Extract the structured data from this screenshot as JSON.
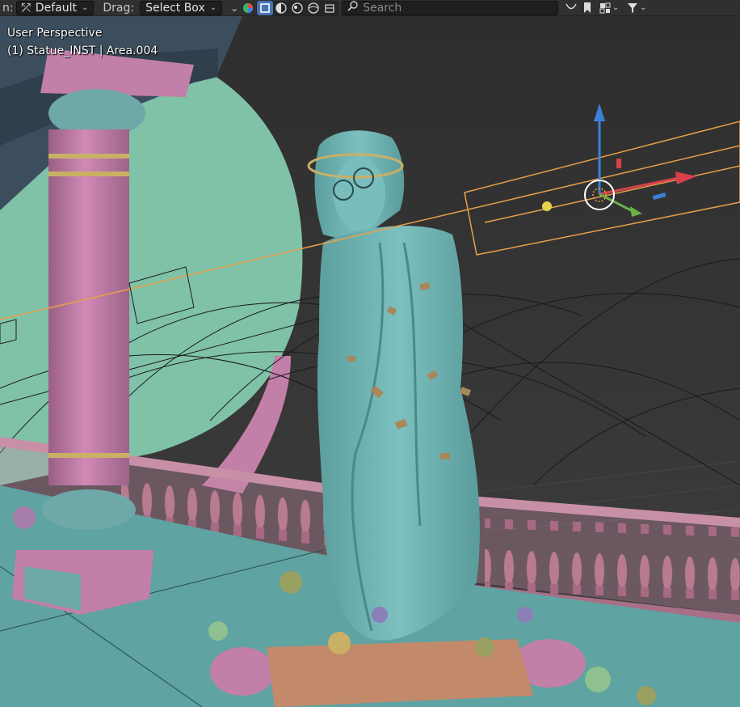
{
  "header": {
    "mode_label_cut": "n:",
    "orientation_value": "Default",
    "drag_label": "Drag:",
    "drag_value": "Select Box",
    "search_placeholder": "Search"
  },
  "overlay": {
    "view_name": "User Perspective",
    "selection_info": "(1) Statue_INST | Area.004"
  },
  "colors": {
    "header_bg": "#303030",
    "viewport_bg": "#3a3a3a",
    "accent": "#4772b3",
    "selection_orange": "#e8a04a",
    "statue": "#6fb3b3",
    "pillar": "#c27fa8",
    "wall_green": "#7fc2a8",
    "floor": "#5fa3a3"
  },
  "icons": [
    "orientation-icon",
    "chevron-down-icon",
    "overlay-color-icon",
    "select-icon",
    "shading-solid-icon",
    "shading-material-icon",
    "shading-rendered-icon",
    "shading-wireframe-icon",
    "search-icon",
    "filter-icon",
    "bookmark-icon",
    "gizmo-icon",
    "funnel-icon"
  ]
}
